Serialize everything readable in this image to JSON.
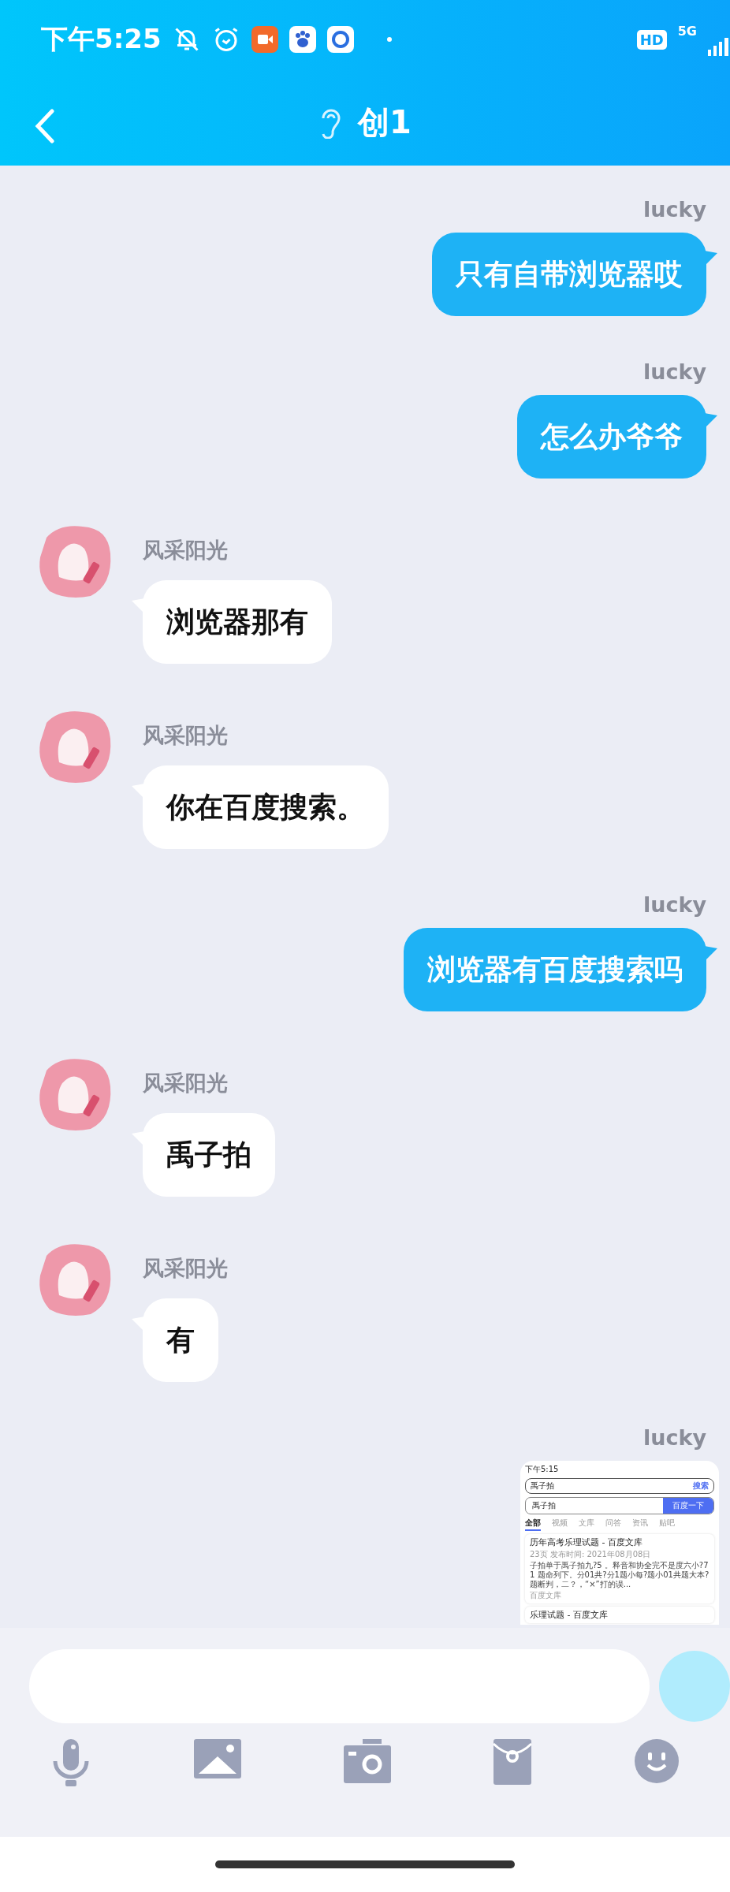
{
  "status_bar": {
    "time": "下午5:25",
    "hd": "HD",
    "network": "5G"
  },
  "header": {
    "title": "创1"
  },
  "messages": [
    {
      "kind": "out",
      "sender": "lucky",
      "text": "只有自带浏览器哎"
    },
    {
      "kind": "out",
      "sender": "lucky",
      "text": "怎么办爷爷"
    },
    {
      "kind": "in",
      "sender": "风采阳光",
      "text": "浏览器那有"
    },
    {
      "kind": "in",
      "sender": "风采阳光",
      "text": "你在百度搜索。"
    },
    {
      "kind": "out",
      "sender": "lucky",
      "text": "浏览器有百度搜索吗"
    },
    {
      "kind": "in",
      "sender": "风采阳光",
      "text": "禹子拍"
    },
    {
      "kind": "in",
      "sender": "风采阳光",
      "text": "有"
    },
    {
      "kind": "out_image",
      "sender": "lucky",
      "shot": {
        "time": "下午5:15",
        "query": "禹子拍",
        "search_button": "搜索",
        "box_query": "禹子拍",
        "box_button": "百度一下",
        "tabs": [
          {
            "label": "全部",
            "selected": true
          },
          {
            "label": "视频",
            "selected": false
          },
          {
            "label": "文库",
            "selected": false
          },
          {
            "label": "问答",
            "selected": false
          },
          {
            "label": "资讯",
            "selected": false
          },
          {
            "label": "贴吧",
            "selected": false
          }
        ],
        "results": [
          {
            "title": "历年高考乐理试题 - 百度文库",
            "meta": "23页 发布时间: 2021年08月08日",
            "snippet": "子拍单于禹子拍九?5 。释音和协全完不是度六小?7 1 题命列下。分01共?分1题小每?题小01共题大本?题断判，二？，“×”打的误...",
            "source": "百度文库"
          },
          {
            "title": "乐理试题 - 百度文库"
          }
        ]
      }
    }
  ]
}
